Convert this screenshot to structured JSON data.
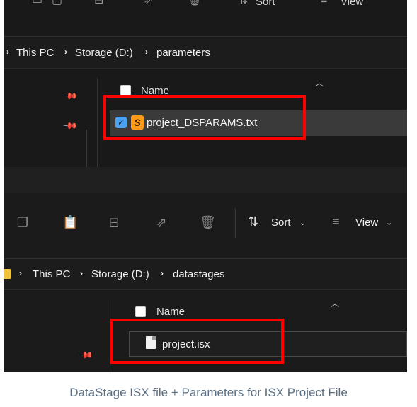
{
  "top_window": {
    "toolbar": {
      "sort_label": "Sort",
      "view_label": "View"
    },
    "breadcrumb": [
      "This PC",
      "Storage (D:)",
      "parameters"
    ],
    "column_header": "Name",
    "file": {
      "name": "project_DSPARAMS.txt",
      "selected": true,
      "icon": "sublime-text-icon"
    }
  },
  "bottom_window": {
    "toolbar": {
      "sort_label": "Sort",
      "view_label": "View"
    },
    "breadcrumb": [
      "This PC",
      "Storage (D:)",
      "datastages"
    ],
    "column_header": "Name",
    "file": {
      "name": "project.isx",
      "icon": "document-icon"
    }
  },
  "highlight_color": "#ff0000",
  "caption": "DataStage ISX file + Parameters for ISX Project File"
}
